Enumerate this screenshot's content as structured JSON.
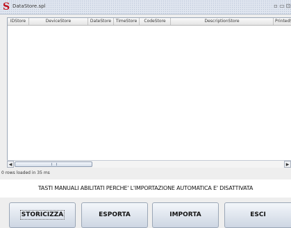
{
  "window": {
    "title": "DataStore.spl",
    "icon": "S",
    "controls": {
      "minimize": "▫",
      "maximize": "▭",
      "close": "⊡"
    }
  },
  "table": {
    "columns": [
      "IDStore",
      "DeviceStore",
      "DateStore",
      "TimeStore",
      "CodeStore",
      "DescriptionStore",
      "PrintedS"
    ],
    "rows": []
  },
  "scrollbar": {
    "left_arrow": "◀",
    "right_arrow": "▶",
    "position": 0.0
  },
  "status": {
    "text": "0 rows loaded  in 35 ms"
  },
  "message": {
    "text": "TASTI MANUALI ABILITATI PERCHE' L'IMPORTAZIONE AUTOMATICA E' DISATTIVATA"
  },
  "buttons": {
    "storicizza": "STORICIZZA",
    "esporta": "ESPORTA",
    "importa": "IMPORTA",
    "esci": "ESCI"
  },
  "colors": {
    "app_icon": "#c1121f",
    "button_gradient_top": "#f3f6fa",
    "button_gradient_bottom": "#cdd6e3"
  }
}
